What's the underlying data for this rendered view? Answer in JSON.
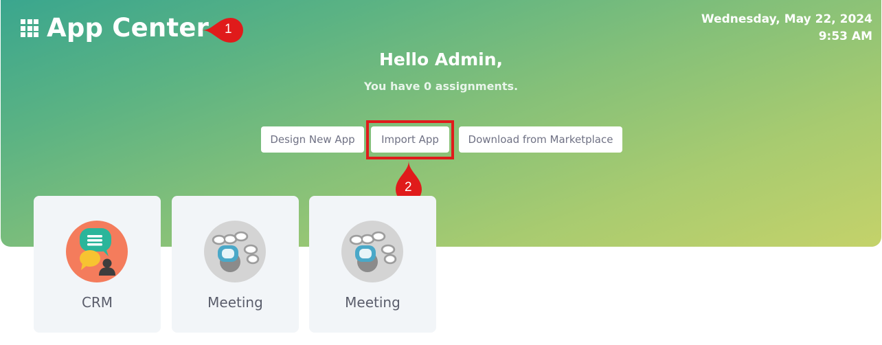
{
  "header": {
    "title": "App Center",
    "date": "Wednesday, May 22, 2024",
    "time": "9:53 AM"
  },
  "welcome": {
    "greeting": "Hello Admin,",
    "assignments": "You have 0 assignments."
  },
  "actions": {
    "design_label": "Design New App",
    "import_label": "Import App",
    "marketplace_label": "Download from Marketplace"
  },
  "callouts": {
    "one": "1",
    "two": "2"
  },
  "apps": [
    {
      "name": "CRM",
      "icon": "crm-icon"
    },
    {
      "name": "Meeting",
      "icon": "meeting-icon"
    },
    {
      "name": "Meeting",
      "icon": "meeting-icon"
    }
  ],
  "colors": {
    "gradient_start": "#3aa68e",
    "gradient_end": "#c4d26a",
    "callout_red": "#e01b1b",
    "crm_orange": "#f47c5c",
    "crm_teal": "#2bb59a"
  }
}
